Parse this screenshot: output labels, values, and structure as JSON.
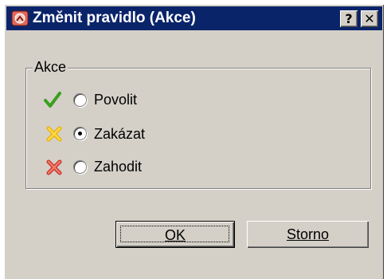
{
  "window": {
    "title": "Změnit pravidlo (Akce)",
    "help_label": "?",
    "close_label": "✕",
    "titlebar_color": "#0a246a"
  },
  "group": {
    "label": "Akce",
    "options": [
      {
        "label": "Povolit",
        "icon": "green-check-icon",
        "selected": false
      },
      {
        "label": "Zakázat",
        "icon": "yellow-x-icon",
        "selected": true
      },
      {
        "label": "Zahodit",
        "icon": "red-x-icon",
        "selected": false
      }
    ]
  },
  "buttons": {
    "ok_label": "OK",
    "storno_label": "Storno"
  }
}
